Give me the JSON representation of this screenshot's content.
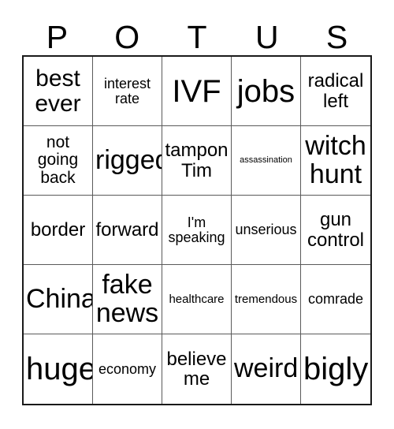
{
  "card": {
    "header_letters": [
      "P",
      "O",
      "T",
      "U",
      "S"
    ],
    "rows": [
      [
        {
          "label": "best ever",
          "size": "lg"
        },
        {
          "label": "interest rate",
          "size": "xs"
        },
        {
          "label": "IVF",
          "size": "xxl"
        },
        {
          "label": "jobs",
          "size": "xxl"
        },
        {
          "label": "radical left",
          "size": "md"
        }
      ],
      [
        {
          "label": "not going back",
          "size": "sm"
        },
        {
          "label": "rigged",
          "size": "xl"
        },
        {
          "label": "tampon Tim",
          "size": "md"
        },
        {
          "label": "assassination",
          "size": "tiny"
        },
        {
          "label": "witch hunt",
          "size": "xl"
        }
      ],
      [
        {
          "label": "border",
          "size": "md"
        },
        {
          "label": "forward",
          "size": "md"
        },
        {
          "label": "I'm speaking",
          "size": "xs"
        },
        {
          "label": "unserious",
          "size": "xs"
        },
        {
          "label": "gun control",
          "size": "md"
        }
      ],
      [
        {
          "label": "China",
          "size": "xl"
        },
        {
          "label": "fake news",
          "size": "xl"
        },
        {
          "label": "healthcare",
          "size": "xxs"
        },
        {
          "label": "tremendous",
          "size": "xxs"
        },
        {
          "label": "comrade",
          "size": "xs"
        }
      ],
      [
        {
          "label": "huge",
          "size": "xxl"
        },
        {
          "label": "economy",
          "size": "xs"
        },
        {
          "label": "believe me",
          "size": "md"
        },
        {
          "label": "weird",
          "size": "xl"
        },
        {
          "label": "bigly",
          "size": "xxl"
        }
      ]
    ]
  },
  "colors": {
    "background": "#ffffff",
    "text": "#000000",
    "outer_border": "#1a1a1a",
    "inner_border": "#5a5a5a"
  }
}
